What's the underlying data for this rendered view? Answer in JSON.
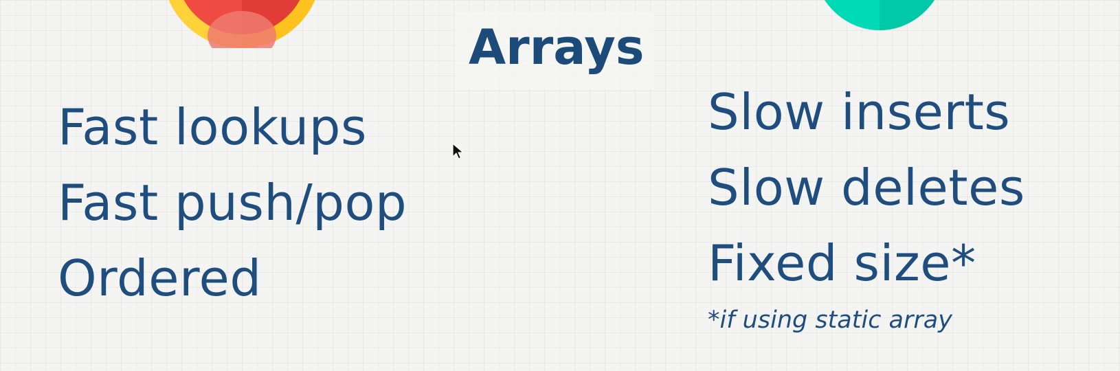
{
  "slide": {
    "title": "Arrays",
    "pros": [
      "Fast lookups",
      "Fast push/pop",
      "Ordered"
    ],
    "cons": [
      "Slow inserts",
      "Slow deletes",
      "Fixed size*"
    ],
    "footnote": "*if using static array"
  },
  "colors": {
    "text": "#1f4e7e",
    "title": "#1c4a79",
    "pros_icon_outer": "#ffd23a",
    "pros_icon_inner": "#ef4b42",
    "cons_icon": "#00d9b6",
    "background": "#f4f4f2"
  },
  "icons": {
    "pros": "thumbs-up-circle-icon",
    "cons": "thumbs-down-circle-icon",
    "cursor": "mouse-pointer-icon"
  }
}
